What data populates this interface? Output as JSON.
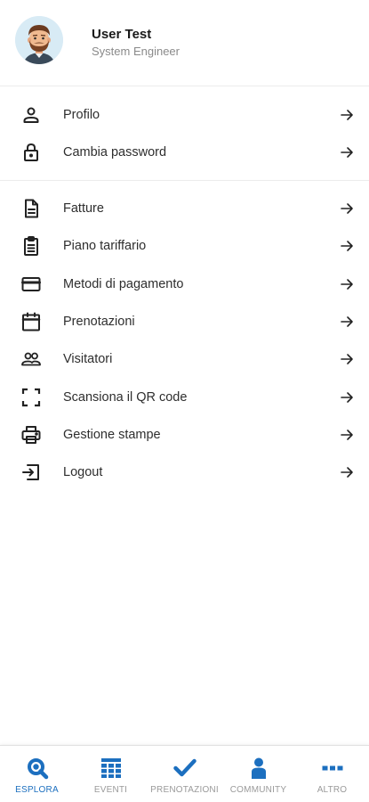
{
  "user": {
    "name": "User Test",
    "role": "System Engineer"
  },
  "menu": {
    "account": [
      {
        "label": "Profilo",
        "icon": "person-icon"
      },
      {
        "label": "Cambia password",
        "icon": "lock-icon"
      }
    ],
    "services": [
      {
        "label": "Fatture",
        "icon": "document-icon"
      },
      {
        "label": "Piano tariffario",
        "icon": "clipboard-icon"
      },
      {
        "label": "Metodi di pagamento",
        "icon": "credit-card-icon"
      },
      {
        "label": "Prenotazioni",
        "icon": "calendar-icon"
      },
      {
        "label": "Visitatori",
        "icon": "people-icon"
      },
      {
        "label": "Scansiona il QR code",
        "icon": "qr-scan-icon"
      },
      {
        "label": "Gestione stampe",
        "icon": "printer-icon"
      },
      {
        "label": "Logout",
        "icon": "logout-icon"
      }
    ]
  },
  "bottom_nav": [
    {
      "label": "ESPLORA",
      "icon": "explore-icon",
      "active": true
    },
    {
      "label": "EVENTI",
      "icon": "grid-icon",
      "active": false
    },
    {
      "label": "PRENOTAZIONI",
      "icon": "check-icon",
      "active": false
    },
    {
      "label": "COMMUNITY",
      "icon": "person-icon",
      "active": false
    },
    {
      "label": "ALTRO",
      "icon": "more-icon",
      "active": false
    }
  ],
  "colors": {
    "accent": "#1c6fbf",
    "inactive": "#9a9a9a",
    "text": "#2e2e2e"
  }
}
